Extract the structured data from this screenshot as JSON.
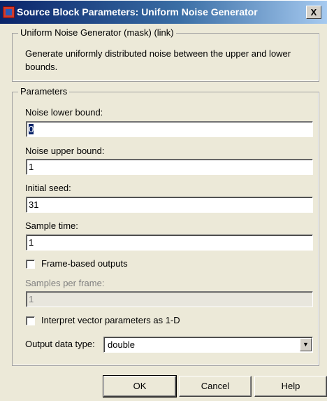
{
  "window": {
    "title": "Source Block Parameters: Uniform Noise Generator",
    "close_label": "X"
  },
  "mask_group": {
    "legend": "Uniform Noise Generator (mask) (link)",
    "description": "Generate uniformly distributed noise between the upper and lower bounds."
  },
  "params_group": {
    "legend": "Parameters",
    "noise_lower": {
      "label": "Noise lower bound:",
      "value": "0"
    },
    "noise_upper": {
      "label": "Noise upper bound:",
      "value": "1"
    },
    "seed": {
      "label": "Initial seed:",
      "value": "31"
    },
    "sample_time": {
      "label": "Sample time:",
      "value": "1"
    },
    "frame_based": {
      "label": "Frame-based outputs",
      "checked": false
    },
    "samples_per_frame": {
      "label": "Samples per frame:",
      "value": "1",
      "disabled": true
    },
    "interpret_1d": {
      "label": "Interpret vector parameters as 1-D",
      "checked": false
    },
    "output_type": {
      "label": "Output data type:",
      "value": "double"
    }
  },
  "buttons": {
    "ok": "OK",
    "cancel": "Cancel",
    "help": "Help"
  }
}
